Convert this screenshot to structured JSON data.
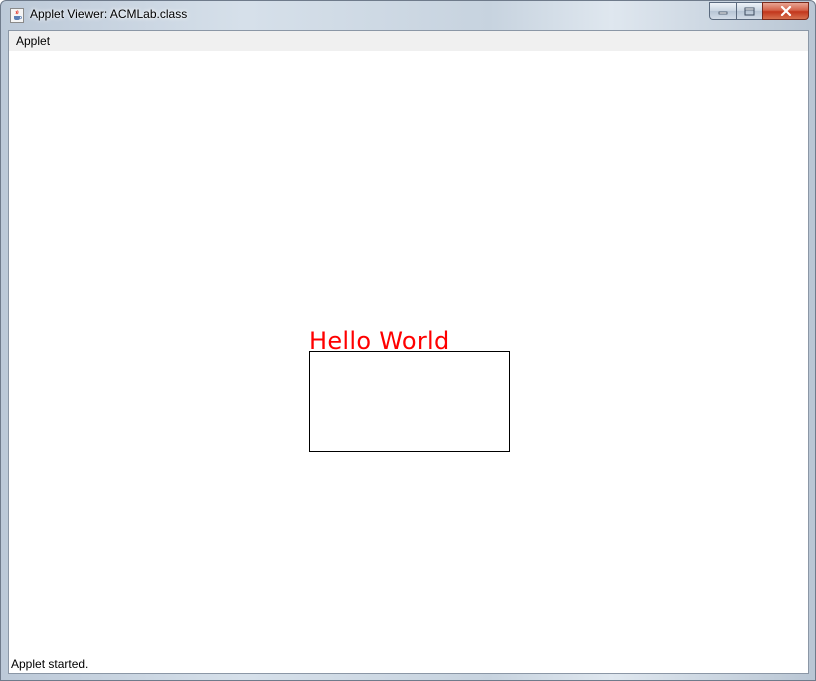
{
  "window": {
    "title": "Applet Viewer: ACMLab.class",
    "icon": "java-cup-icon",
    "buttons": {
      "minimize": "minimize-icon",
      "maximize": "maximize-icon",
      "close": "close-icon"
    }
  },
  "menubar": {
    "items": [
      {
        "label": "Applet"
      }
    ]
  },
  "canvas": {
    "label_text": "Hello World",
    "label_color": "#ff0000",
    "rect_stroke": "#000000"
  },
  "status": {
    "text": "Applet started."
  }
}
